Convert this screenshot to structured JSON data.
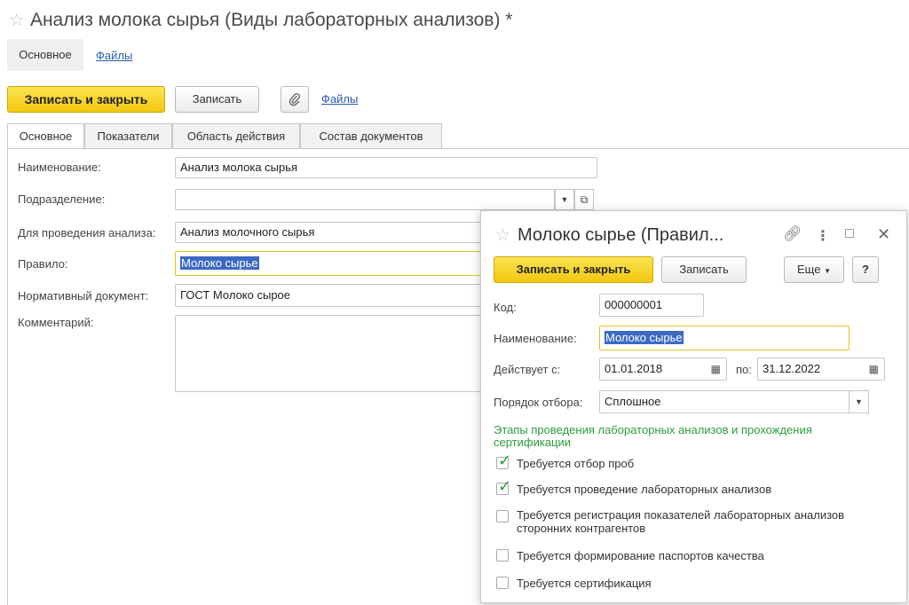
{
  "window": {
    "title": "Анализ молока сырья (Виды лабораторных анализов) *"
  },
  "nav": {
    "main": "Основное",
    "files": "Файлы"
  },
  "toolbar": {
    "save_close": "Записать и закрыть",
    "save": "Записать",
    "files": "Файлы"
  },
  "tabs": [
    "Основное",
    "Показатели",
    "Область действия",
    "Состав документов"
  ],
  "form": {
    "name_label": "Наименование:",
    "name_value": "Анализ молока сырья",
    "division_label": "Подразделение:",
    "division_value": "",
    "purpose_label": "Для проведения анализа:",
    "purpose_value": "Анализ молочного сырья",
    "rule_label": "Правило:",
    "rule_value": "Молоко сырье",
    "normdoc_label": "Нормативный документ:",
    "normdoc_value": "ГОСТ Молоко сырое",
    "comment_label": "Комментарий:",
    "comment_value": ""
  },
  "dialog": {
    "title": "Молоко сырье (Правил...",
    "save_close": "Записать и закрыть",
    "save": "Записать",
    "more": "Еще",
    "help": "?",
    "code_label": "Код:",
    "code_value": "000000001",
    "name_label": "Наименование:",
    "name_value": "Молоко сырье",
    "valid_from_label": "Действует с:",
    "valid_from": "01.01.2018",
    "valid_to_label": "по:",
    "valid_to": "31.12.2022",
    "selection_label": "Порядок отбора:",
    "selection_value": "Сплошное",
    "stages_heading": "Этапы проведения лабораторных анализов и прохождения сертификации",
    "checks": [
      {
        "label": "Требуется отбор проб",
        "checked": true
      },
      {
        "label": "Требуется проведение лабораторных анализов",
        "checked": true
      },
      {
        "label": "Требуется регистрация показателей лабораторных анализов сторонних контрагентов",
        "checked": false
      },
      {
        "label": "Требуется формирование паспортов качества",
        "checked": false
      },
      {
        "label": "Требуется сертификация",
        "checked": false
      }
    ]
  },
  "colors": {
    "accent_yellow": "#f2c80f",
    "link_blue": "#2a5db0",
    "heading_green": "#2e9c3b",
    "selection_blue": "#3d69c2"
  }
}
